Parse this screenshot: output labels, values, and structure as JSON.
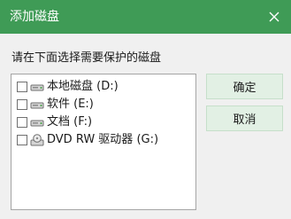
{
  "window": {
    "title": "添加磁盘",
    "accent_color": "#3f9b56"
  },
  "prompt": "请在下面选择需要保护的磁盘",
  "drives": [
    {
      "label": "本地磁盘 (D:)",
      "checked": false,
      "icon": "hard-drive-icon"
    },
    {
      "label": "软件 (E:)",
      "checked": false,
      "icon": "hard-drive-icon"
    },
    {
      "label": "文档 (F:)",
      "checked": false,
      "icon": "hard-drive-icon"
    },
    {
      "label": "DVD RW 驱动器 (G:)",
      "checked": false,
      "icon": "dvd-drive-icon"
    }
  ],
  "buttons": {
    "ok": "确定",
    "cancel": "取消"
  }
}
